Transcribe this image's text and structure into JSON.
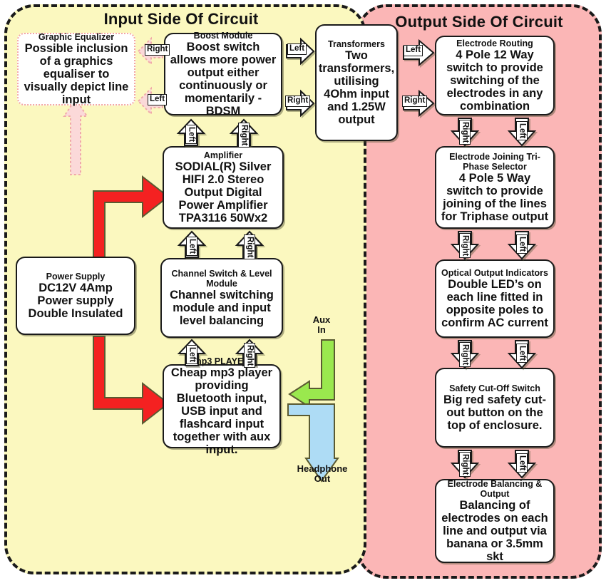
{
  "panels": {
    "input": {
      "title": "Input Side Of Circuit",
      "bg": "#fbf8bf"
    },
    "output": {
      "title": "Output Side Of Circuit",
      "bg": "#fbb6b6"
    }
  },
  "boxes": {
    "graphic_equalizer": {
      "header": "Graphic Equalizer",
      "body": "Possible inclusion of a graphics equaliser to visually depict line input"
    },
    "boost_module": {
      "header": "Boost Module",
      "body": "Boost switch allows more power output either continuously or momentarily - BDSM"
    },
    "transformers": {
      "header": "Transformers",
      "body": "Two transformers, utilising 4Ohm input and 1.25W output"
    },
    "amplifier": {
      "header": "Amplifier",
      "body": "SODIAL(R) Silver HIFI 2.0 Stereo Output Digital Power Amplifier TPA3116 50Wx2"
    },
    "power_supply": {
      "header": "Power Supply",
      "body": "DC12V 4Amp Power supply Double Insulated"
    },
    "channel_switch": {
      "header": "Channel Switch & Level Module",
      "body": "Channel switching module and input level balancing"
    },
    "mp3_player": {
      "header": "mp3 PLAYER",
      "body": "Cheap mp3 player providing Bluetooth input, USB input and flashcard input together with aux input."
    },
    "electrode_routing": {
      "header": "Electrode Routing",
      "body": "4 Pole 12 Way switch to provide switching of the electrodes in any combination"
    },
    "electrode_joining": {
      "header": "Electrode Joining Tri-Phase Selector",
      "body": "4 Pole 5 Way switch to provide joining of the lines for Triphase output"
    },
    "optical_output": {
      "header": "Optical Output Indicators",
      "body": "Double LED’s on each line fitted in opposite poles to confirm AC current"
    },
    "safety_cutoff": {
      "header": "Safety Cut-Off Switch",
      "body": "Big red safety cut-out button on the top of enclosure."
    },
    "electrode_balancing": {
      "header": "Electrode Balancing & Output",
      "body": "Balancing of electrodes on each line and output via banana or 3.5mm skt"
    }
  },
  "arrow_labels": {
    "eq_right": "Right",
    "eq_left": "Left",
    "boost_to_transformer_left": "Left",
    "boost_to_transformer_right": "Right",
    "transformer_to_routing_left": "Left",
    "transformer_to_routing_right": "Right",
    "amp_to_boost_left": "Left",
    "amp_to_boost_right": "Right",
    "chan_to_amp_left": "Left",
    "chan_to_amp_right": "Right",
    "mp3_to_chan_left": "Left",
    "mp3_to_chan_right": "Right",
    "routing_to_joining_right": "Right",
    "routing_to_joining_left": "Left",
    "joining_to_optical_right": "Right",
    "joining_to_optical_left": "Left",
    "optical_to_safety_right": "Right",
    "optical_to_safety_left": "Left",
    "safety_to_balancing_right": "Right",
    "safety_to_balancing_left": "Left"
  },
  "free_labels": {
    "aux_in": "Aux\nIn",
    "headphone_out": "Headphone\nOut"
  },
  "colors": {
    "input_panel": "#fbf8bf",
    "output_panel": "#fbb6b6",
    "power_connector": "#f42121",
    "aux_connector": "#9ae84e",
    "headphone_connector": "#aedcf5",
    "equalizer_connector": "#fbd9d9",
    "box_fill": "#ffffff",
    "outline": "#1a1a1a"
  }
}
